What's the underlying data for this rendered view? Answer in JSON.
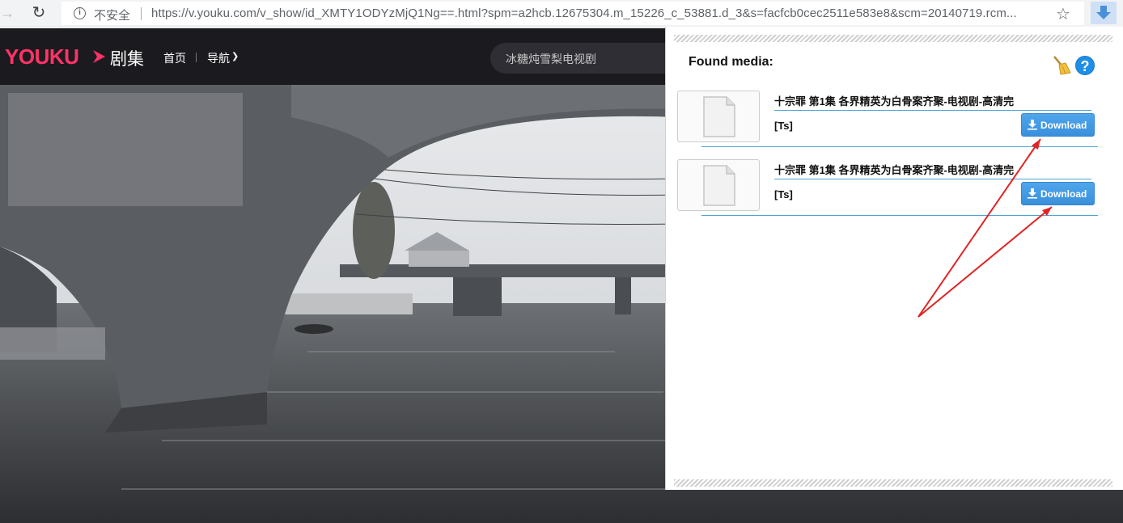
{
  "browser": {
    "security_label": "不安全",
    "url": "https://v.youku.com/v_show/id_XMTY1ODYzMjQ1Ng==.html?spm=a2hcb.12675304.m_15226_c_53881.d_3&s=facfcb0cec2511e583e8&scm=20140719.rcm...",
    "icons": [
      "back-arrow-icon",
      "reload-icon",
      "info-icon",
      "star-icon",
      "download-extension-icon"
    ]
  },
  "site": {
    "logo_text": "YOUKU",
    "channel_label": "剧集",
    "nav": {
      "home": "首页",
      "menu": "导航"
    },
    "search_placeholder": "冰糖炖雪梨电视剧",
    "brand_color": "#ff3366"
  },
  "popup": {
    "title": "Found media:",
    "items": [
      {
        "title": "十宗罪 第1集 各界精英为白骨案齐聚-电视剧-高清完",
        "format": "[Ts]",
        "button_label": "Download"
      },
      {
        "title": "十宗罪 第1集 各界精英为白骨案齐聚-电视剧-高清完",
        "format": "[Ts]",
        "button_label": "Download"
      }
    ],
    "accent_color": "#3a8fdb"
  }
}
